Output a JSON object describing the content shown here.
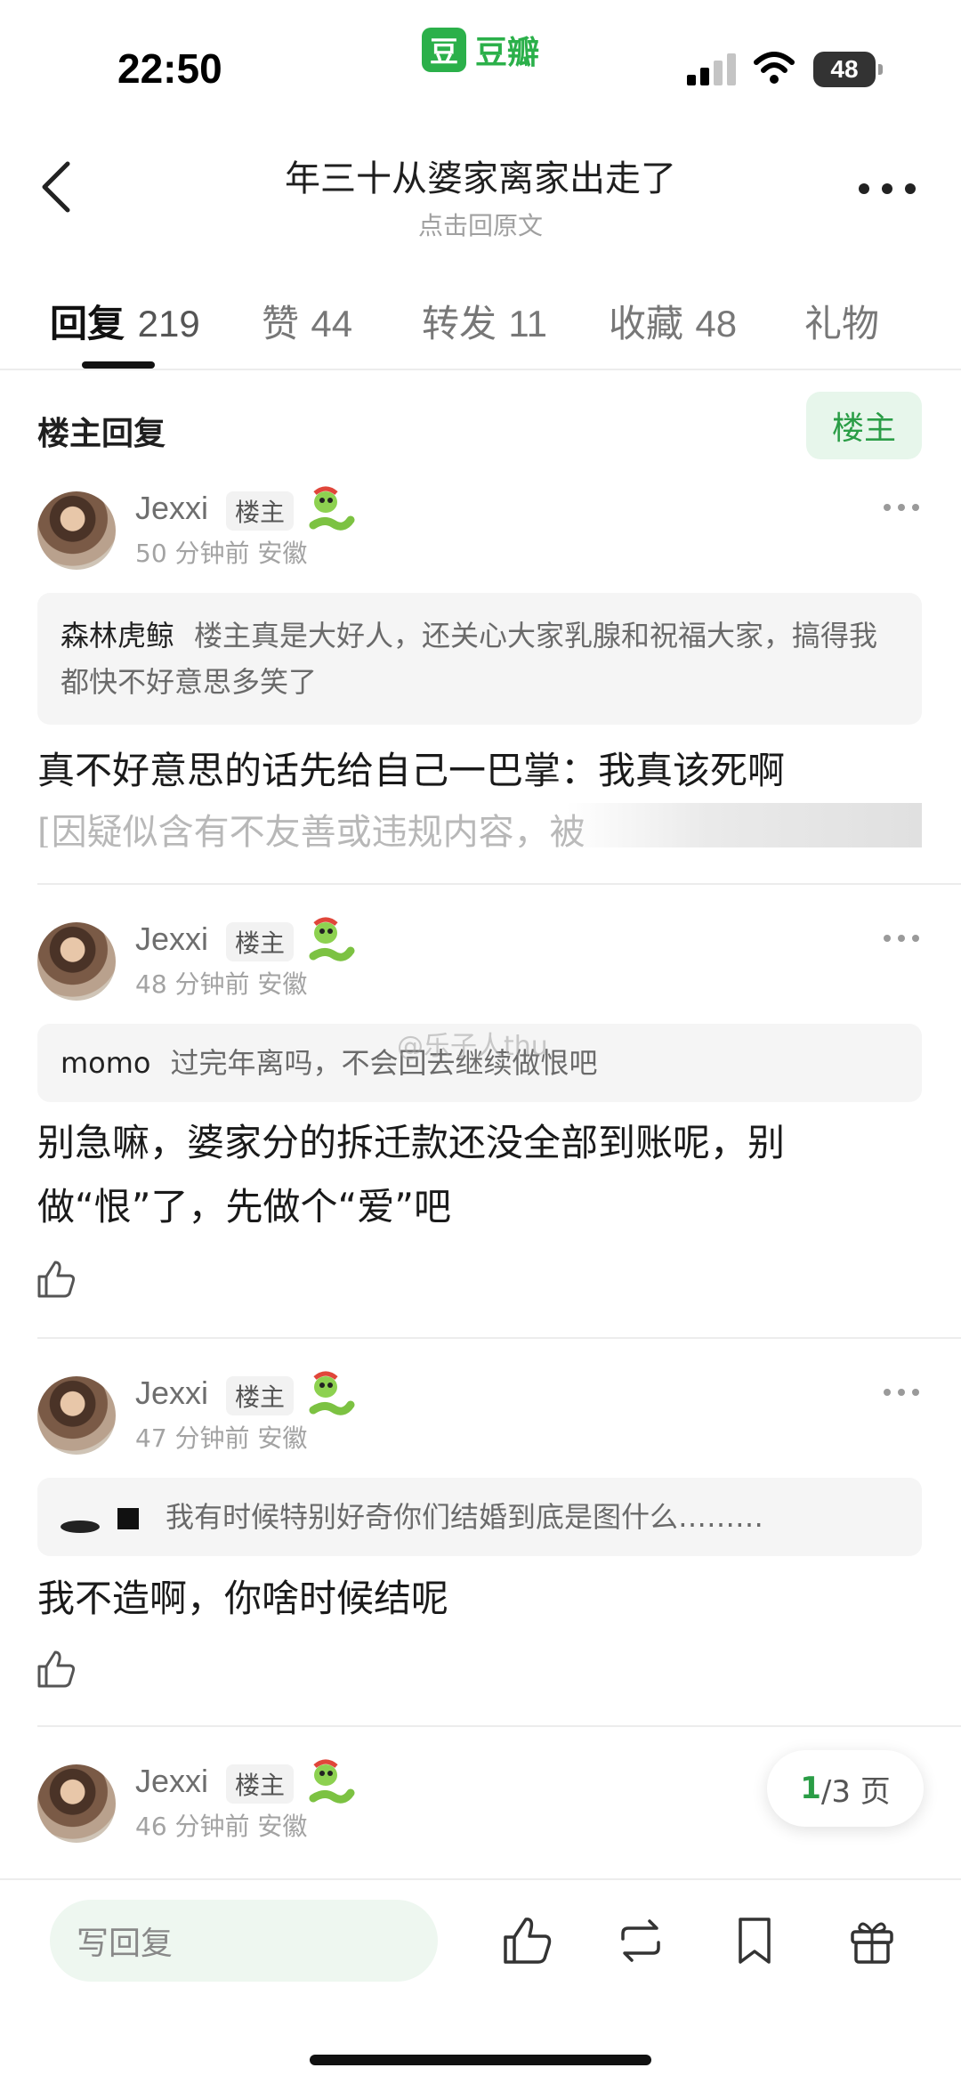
{
  "status_bar": {
    "time": "22:50",
    "app_logo_char": "豆",
    "app_name": "豆瓣",
    "battery": "48"
  },
  "header": {
    "title": "年三十从婆家离家出走了",
    "subtitle": "点击回原文"
  },
  "tabs": [
    {
      "label": "回复",
      "count": "219",
      "active": true
    },
    {
      "label": "赞",
      "count": "44"
    },
    {
      "label": "转发",
      "count": "11"
    },
    {
      "label": "收藏",
      "count": "48"
    },
    {
      "label": "礼物",
      "count": ""
    }
  ],
  "section": {
    "title": "楼主回复",
    "filter_chip": "楼主"
  },
  "replies": [
    {
      "user": "Jexxi",
      "badge": "楼主",
      "meta": "50 分钟前 安徽",
      "quote_name": "森林虎鲸",
      "quote_text": "楼主真是大好人，还关心大家乳腺和祝福大家，搞得我都快不好意思多笑了",
      "body": "真不好意思的话先给自己一巴掌：我真该死啊",
      "hidden": "[因疑似含有不友善或违规内容，被"
    },
    {
      "user": "Jexxi",
      "badge": "楼主",
      "meta": "48 分钟前 安徽",
      "quote_name": "momo",
      "quote_text": "过完年离吗，不会回去继续做恨吧",
      "body": "别急嘛，婆家分的拆迁款还没全部到账呢，别做“恨”了，先做个“爱”吧"
    },
    {
      "user": "Jexxi",
      "badge": "楼主",
      "meta": "47 分钟前 安徽",
      "quote_text": "我有时候特别好奇你们结婚到底是图什么………",
      "body": "我不造啊，你啥时候结呢"
    },
    {
      "user": "Jexxi",
      "badge": "楼主",
      "meta": "46 分钟前 安徽"
    }
  ],
  "watermark": "@乐子人thu",
  "pagination": {
    "current": "1",
    "rest": "/3 页"
  },
  "bottom_bar": {
    "placeholder": "写回复"
  },
  "icons": [
    "back-icon",
    "more-icon",
    "snake-emoji-icon",
    "like-icon",
    "repost-icon",
    "bookmark-icon",
    "gift-icon",
    "wifi-icon",
    "signal-icon"
  ],
  "colors": {
    "brand_green": "#2bb04a",
    "chip_text_green": "#2a9d46",
    "chip_bg": "#e7f6eb"
  }
}
